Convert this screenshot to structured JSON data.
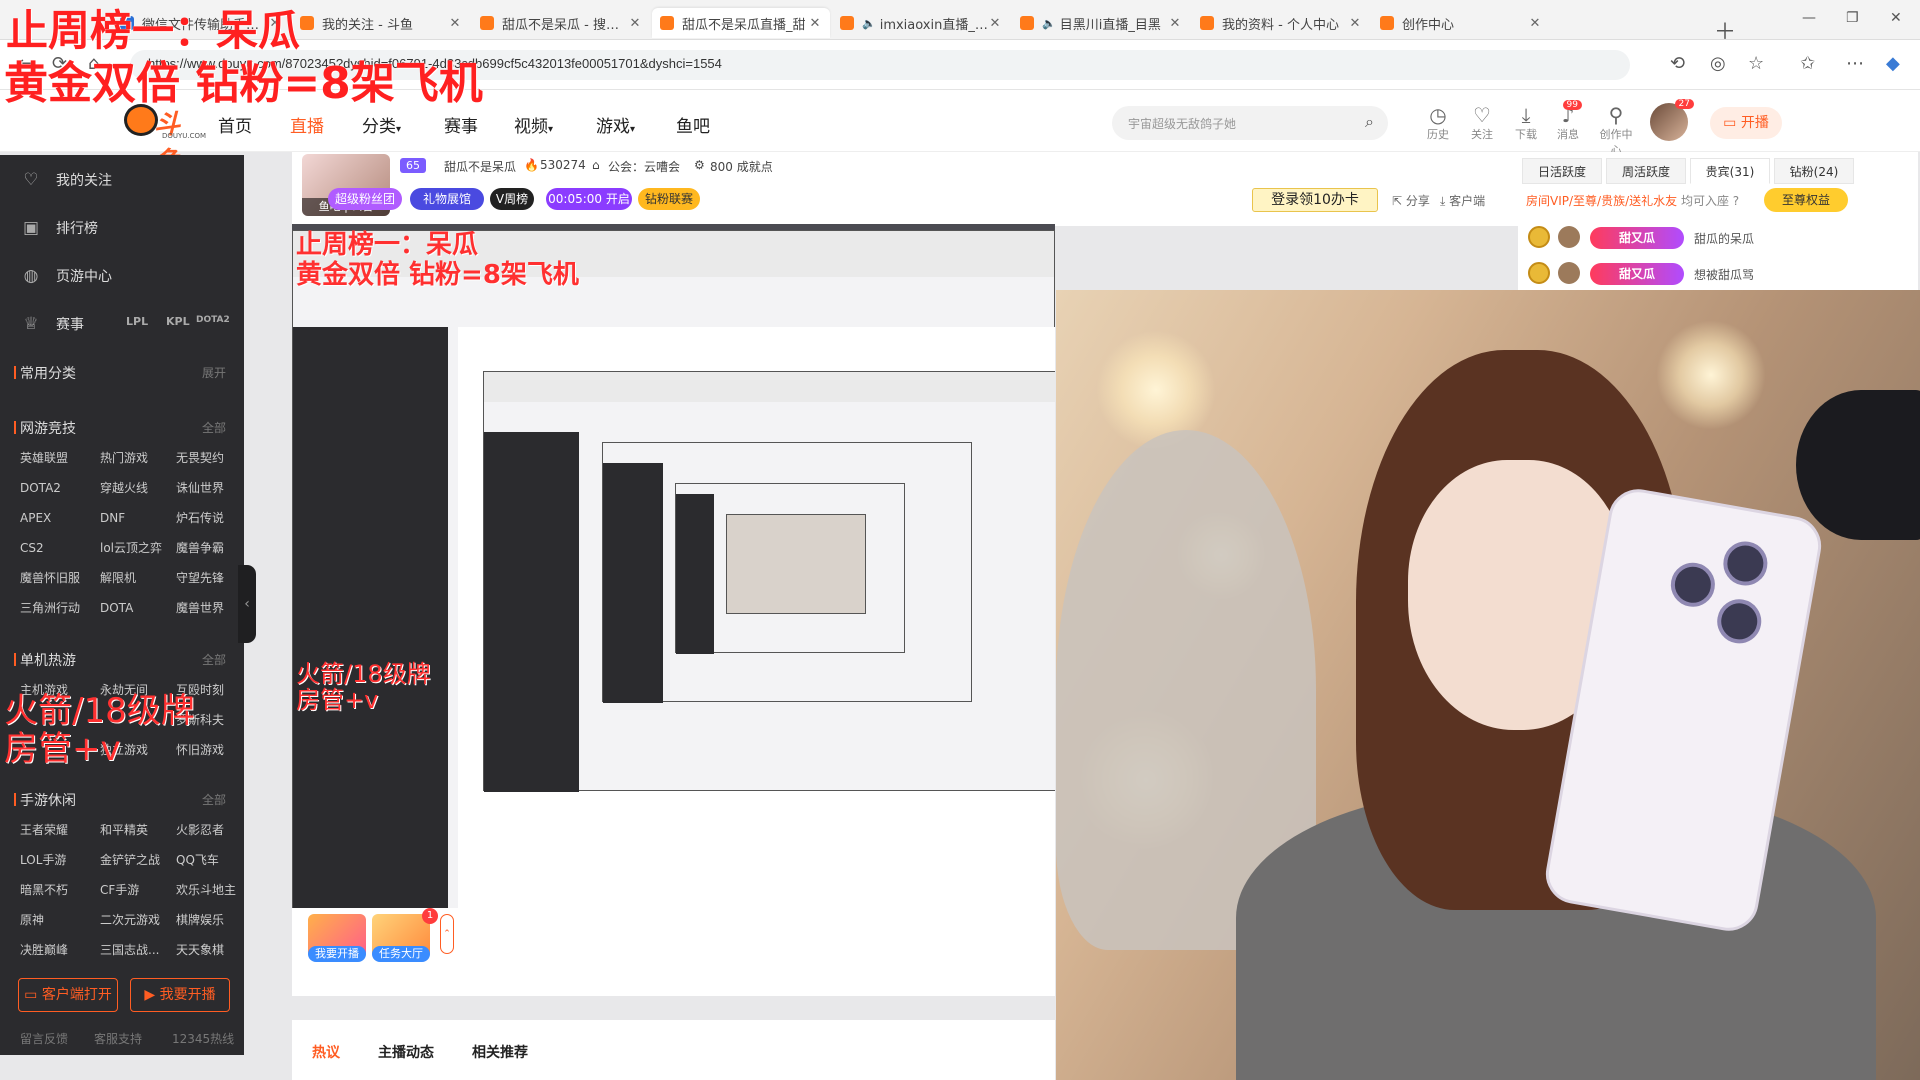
{
  "browser": {
    "tabs": [
      {
        "title": "微信文件传输助手网页",
        "speaker": false,
        "active": false
      },
      {
        "title": "我的关注 - 斗鱼",
        "speaker": false,
        "active": false
      },
      {
        "title": "甜瓜不是呆瓜 - 搜索结",
        "speaker": false,
        "active": false
      },
      {
        "title": "甜瓜不是呆瓜直播_甜",
        "speaker": false,
        "active": true
      },
      {
        "title": "imxiaoxin直播_im",
        "speaker": true,
        "active": false
      },
      {
        "title": "目黑川i直播_目黑",
        "speaker": true,
        "active": false
      },
      {
        "title": "我的资料 - 个人中心",
        "speaker": false,
        "active": false
      },
      {
        "title": "创作中心",
        "speaker": false,
        "active": false
      }
    ],
    "url": "https://www.douyu.com/8702345?dyshid=f06791-4d33cdb699cf5c432013fe00051701&dyshci=1554"
  },
  "overlay": {
    "line1": "止周榜一：呆瓜",
    "line2": "黄金双倍 钻粉=8架飞机",
    "left_line1": "火箭/18级牌",
    "left_line2": "房管+v"
  },
  "header": {
    "logo_word": "斗鱼",
    "logo_sub": "DOUYU.COM",
    "nav": [
      "首页",
      "直播",
      "分类",
      "赛事",
      "视频",
      "游戏",
      "鱼吧"
    ],
    "active_nav": "直播",
    "search_placeholder": "宇宙超级无敌鸽子她",
    "icons": [
      {
        "name": "history",
        "label": "历史"
      },
      {
        "name": "follow",
        "label": "关注"
      },
      {
        "name": "download",
        "label": "下载"
      },
      {
        "name": "message",
        "label": "消息",
        "badge": "99"
      },
      {
        "name": "creator",
        "label": "创作中心"
      }
    ],
    "avatar_badge": "27",
    "start_label": "开播"
  },
  "sidebar": {
    "top_items": [
      "我的关注",
      "排行榜",
      "页游中心",
      "赛事"
    ],
    "game_logos": [
      "LPL",
      "KPL",
      "DOTA2"
    ],
    "common_label": "常用分类",
    "expand_label": "展开",
    "sections": [
      {
        "title": "网游竞技",
        "more": "全部",
        "items": [
          "英雄联盟",
          "热门游戏",
          "无畏契约",
          "DOTA2",
          "穿越火线",
          "诛仙世界",
          "APEX",
          "DNF",
          "炉石传说",
          "CS2",
          "lol云顶之弈",
          "魔兽争霸",
          "魔兽怀旧服",
          "解限机",
          "守望先锋",
          "三角洲行动",
          "DOTA",
          "魔兽世界"
        ]
      },
      {
        "title": "单机热游",
        "more": "全部",
        "items": [
          "主机游戏",
          "永劫无间",
          "互殴时刻",
          "",
          "",
          "罗斯科夫",
          "",
          "独立游戏",
          "怀旧游戏"
        ]
      },
      {
        "title": "手游休闲",
        "more": "全部",
        "items": [
          "王者荣耀",
          "和平精英",
          "火影忍者",
          "LOL手游",
          "金铲铲之战",
          "QQ飞车",
          "暗黑不朽",
          "CF手游",
          "欢乐斗地主",
          "原神",
          "二次元游戏",
          "棋牌娱乐",
          "决胜巅峰",
          "三国志战...",
          "天天象棋"
        ]
      }
    ],
    "client_btn": "客户端打开",
    "start_btn": "我要开播",
    "footer": [
      "留言反馈",
      "客服支持",
      "12345热线"
    ]
  },
  "room": {
    "level": "65",
    "name": "甜瓜不是呆瓜",
    "heat": "530274",
    "guild": "公会：云嘈会",
    "watch": "800 成就点",
    "avatar_caption": "鱼吧 | 公告",
    "pills": [
      {
        "label": "超级粉丝团",
        "color": "#b05cff"
      },
      {
        "label": "礼物展馆",
        "color": "#4a4ae0"
      },
      {
        "label": "V周榜",
        "color": "#222222"
      },
      {
        "label": "00:05:00  开启",
        "color": "#8b3cff"
      },
      {
        "label": "钻粉联赛",
        "color": "#ffb81f"
      }
    ],
    "login_gift": "登录领10办卡",
    "share": "分享",
    "client": "客户端"
  },
  "rank_panel": {
    "tabs": [
      "日活跃度",
      "周活跃度",
      "贵宾(31)",
      "钻粉(24)"
    ],
    "active_tab": "贵宾(31)",
    "vip_text": "房间VIP/至尊/贵族/送礼水友",
    "vip_tail": "均可入座",
    "vip_btn": "至尊权益",
    "rows": [
      {
        "tag": "甜又瓜",
        "name": "甜瓜的呆瓜"
      },
      {
        "tag": "甜又瓜",
        "name": "想被甜瓜骂"
      }
    ]
  },
  "gifts": {
    "start_label": "我要开播",
    "task_label": "任务大厅",
    "task_badge": "1"
  },
  "bottom_tabs": [
    "热议",
    "主播动态",
    "相关推荐"
  ],
  "active_bottom_tab": "热议"
}
